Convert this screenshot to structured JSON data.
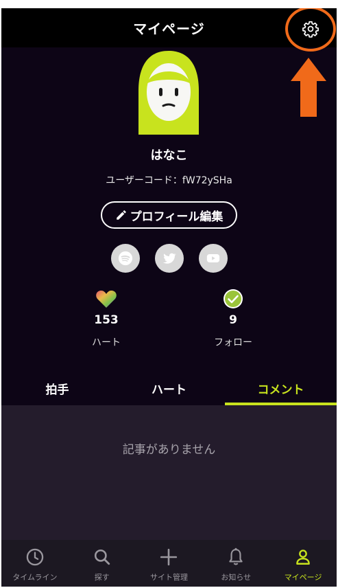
{
  "header": {
    "title": "マイページ"
  },
  "profile": {
    "name": "はなこ",
    "user_code": "ユーザーコード：fW72ySHa",
    "edit_label": "プロフィール編集"
  },
  "social": [
    "spotify-icon",
    "twitter-icon",
    "youtube-icon"
  ],
  "stats": {
    "hearts": {
      "value": "153",
      "label": "ハート"
    },
    "follow": {
      "value": "9",
      "label": "フォロー"
    }
  },
  "tabs": [
    {
      "label": "拍手",
      "active": false
    },
    {
      "label": "ハート",
      "active": false
    },
    {
      "label": "コメント",
      "active": true
    }
  ],
  "content": {
    "empty_message": "記事がありません"
  },
  "bottom_nav": [
    {
      "label": "タイムライン",
      "icon": "clock-icon",
      "active": false
    },
    {
      "label": "探す",
      "icon": "search-icon",
      "active": false
    },
    {
      "label": "サイト管理",
      "icon": "plus-icon",
      "active": false
    },
    {
      "label": "お知らせ",
      "icon": "bell-icon",
      "active": false
    },
    {
      "label": "マイページ",
      "icon": "person-icon",
      "active": true
    }
  ],
  "colors": {
    "accent": "#c8e31e",
    "background": "#0d0516",
    "annotation": "#f06a1a"
  }
}
